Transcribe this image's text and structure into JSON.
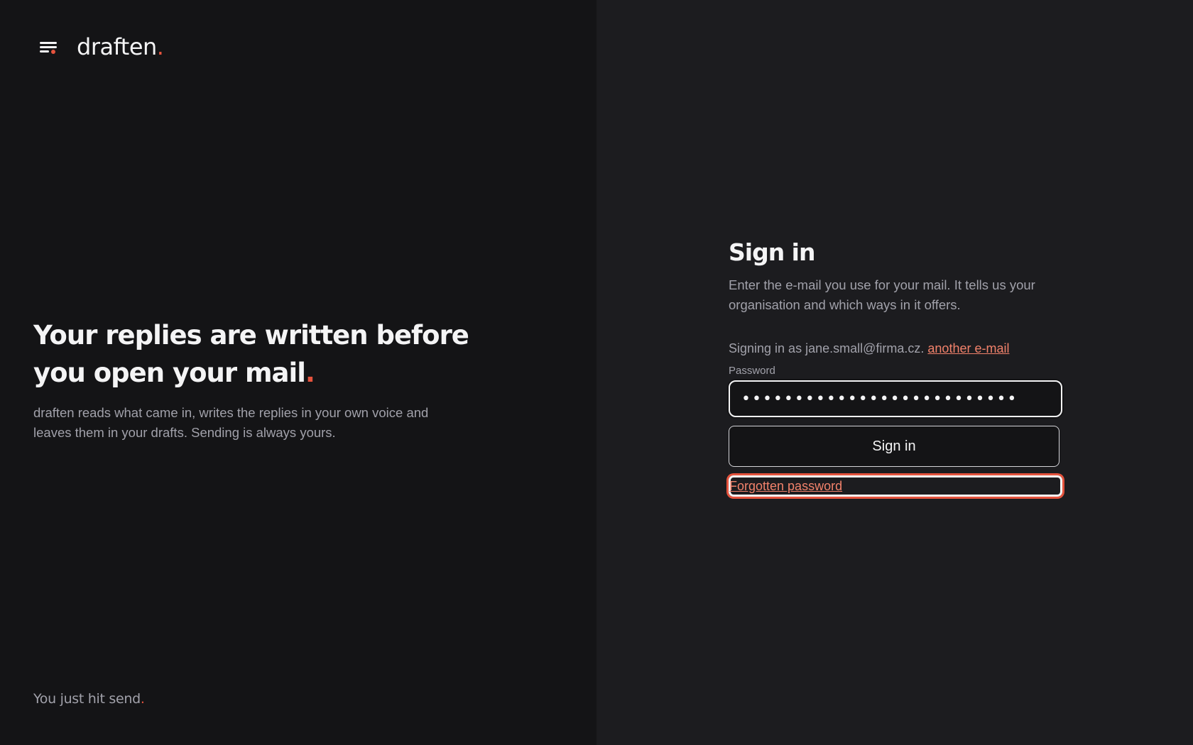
{
  "brand": {
    "name": "draften",
    "dot": ".",
    "menu_icon": "menu-icon",
    "accent_color": "#e5533d"
  },
  "hero": {
    "headline_line1": "Your replies are written before",
    "headline_line2": "you open your mail",
    "headline_dot": ".",
    "description": "draften reads what came in, writes the replies in your own voice and leaves them in your drafts. Sending is always yours."
  },
  "tagline": {
    "text": "You just hit send",
    "dot": "."
  },
  "signin": {
    "title": "Sign in",
    "intro": "Enter the e-mail you use for your mail. It tells us your organisation and which ways in it offers.",
    "signing_as": "Signing in as jane.small@firma.cz.",
    "another_email_link": "another e-mail",
    "password_label": "Password",
    "password_value": "••••••••••••••••••••••••••",
    "submit_label": "Sign in",
    "forgot_link": "Forgotten password",
    "link_color": "#f2826b"
  }
}
